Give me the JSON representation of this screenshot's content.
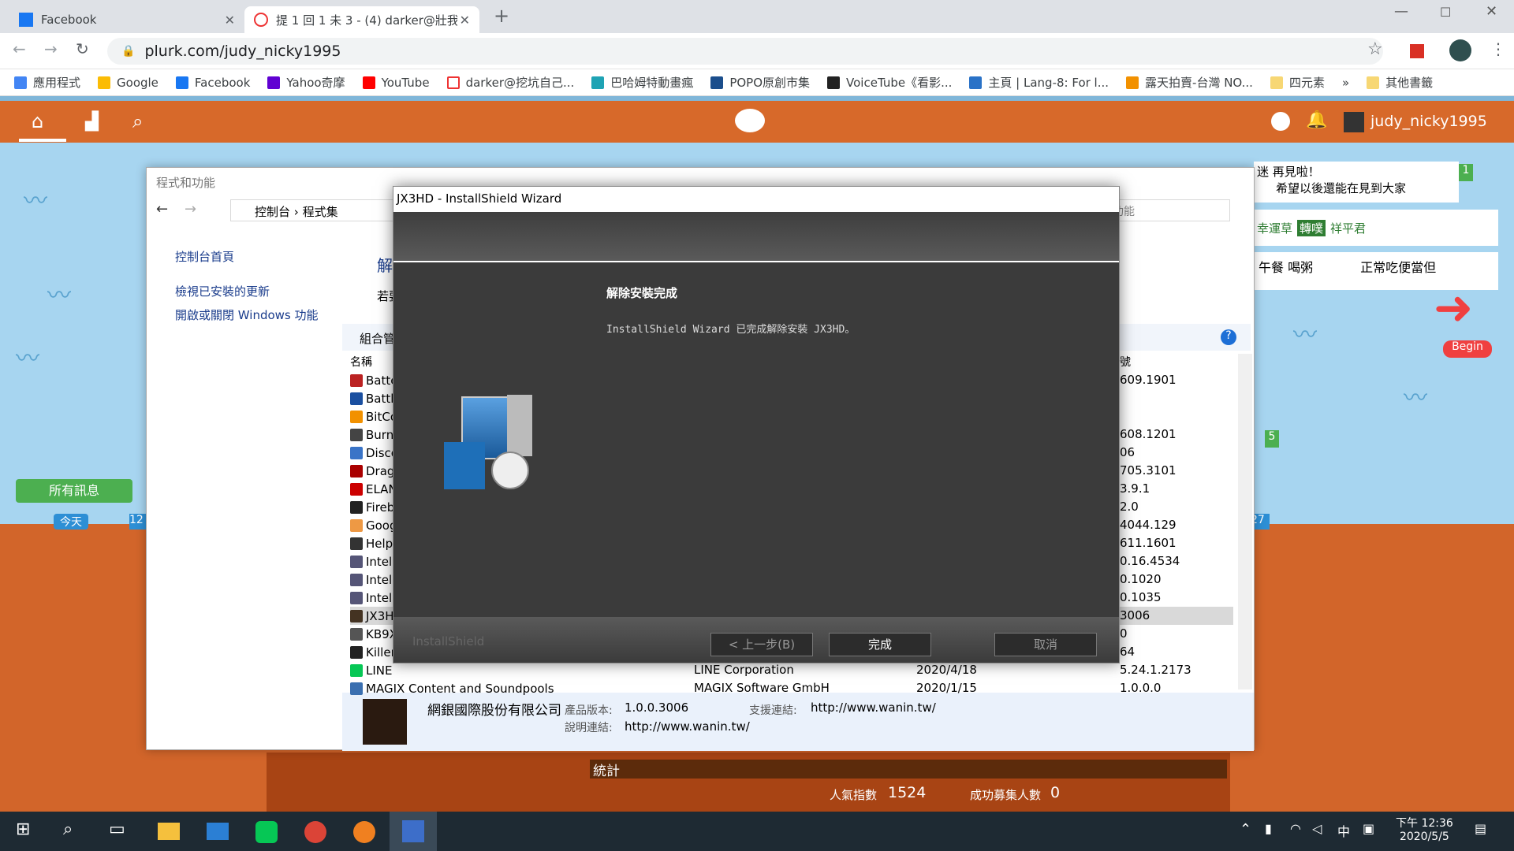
{
  "browser": {
    "tabs": [
      {
        "title": "Facebook"
      },
      {
        "title": "提 1 回 1 未 3 - (4) darker@壯我"
      }
    ],
    "url": "plurk.com/judy_nicky1995",
    "bookmarks": [
      "應用程式",
      "Google",
      "Facebook",
      "Yahoo奇摩",
      "YouTube",
      "darker@挖坑自己...",
      "巴哈姆特動畫瘋",
      "POPO原創市集",
      "VoiceTube《看影...",
      "主頁 | Lang-8: For l...",
      "露天拍賣-台灣 NO...",
      "四元素",
      "»",
      "其他書籤"
    ]
  },
  "plurk": {
    "username": "judy_nicky1995",
    "all_messages": "所有訊息",
    "today": "今天",
    "num12": "12",
    "num27": "27",
    "badge1": "1",
    "badge5": "5",
    "begin": "Begin",
    "bubble1": "迷 再見啦！",
    "bubble1b": "希望以後還能在見到大家",
    "lucky": "幸運草",
    "retweet": "轉噗",
    "peace": "祥平君",
    "lunch": "午餐 喝粥",
    "normal": "正常吃便當但",
    "stats": "統計",
    "popularity_label": "人氣指數",
    "popularity_value": "1524",
    "recruit_label": "成功募集人數",
    "recruit_value": "0"
  },
  "control_panel": {
    "title": "程式和功能",
    "breadcrumb": [
      "控制台",
      "程式集"
    ],
    "side_links": [
      "控制台首頁",
      "檢視已安裝的更新",
      "開啟或關閉 Windows 功能"
    ],
    "heading_partial": "解",
    "sub_partial": "若要",
    "organize": "組合管",
    "col_name": "名稱",
    "col_version_partial": "號",
    "search_partial": "功能",
    "rows": [
      {
        "name": "Batte",
        "ver": "609.1901"
      },
      {
        "name": "Battle",
        "ver": ""
      },
      {
        "name": "BitCo",
        "ver": ""
      },
      {
        "name": "Burn",
        "ver": "608.1201"
      },
      {
        "name": "Disco",
        "ver": "06"
      },
      {
        "name": "Drag",
        "ver": "705.3101"
      },
      {
        "name": "ELAN",
        "ver": "3.9.1"
      },
      {
        "name": "Fireb",
        "ver": "2.0"
      },
      {
        "name": "Goog",
        "ver": "4044.129"
      },
      {
        "name": "Help",
        "ver": "611.1601"
      },
      {
        "name": "Intel(",
        "ver": "0.16.4534"
      },
      {
        "name": "Intel(",
        "ver": "0.1020"
      },
      {
        "name": "Intel(",
        "ver": "0.1035"
      },
      {
        "name": "JX3H",
        "ver": "3006"
      },
      {
        "name": "KB9X",
        "ver": "0"
      },
      {
        "name": "Killer",
        "ver": "64"
      },
      {
        "name": "LINE",
        "ver": "5.24.1.2173",
        "publisher": "LINE Corporation",
        "date": "2020/4/18"
      },
      {
        "name": "MAGIX Content and Soundpools",
        "ver": "1.0.0.0",
        "publisher": "MAGIX Software GmbH",
        "date": "2020/1/15"
      }
    ],
    "detail": {
      "company": "網銀國際股份有限公司",
      "product_version_label": "產品版本:",
      "product_version": "1.0.0.3006",
      "support_label": "支援連結:",
      "support_url": "http://www.wanin.tw/",
      "help_label": "說明連結:",
      "help_url": "http://www.wanin.tw/"
    }
  },
  "wizard": {
    "title": "JX3HD - InstallShield Wizard",
    "heading": "解除安裝完成",
    "message": "InstallShield Wizard 已完成解除安裝 JX3HD。",
    "brand": "InstallShield",
    "back": "< 上一步(B)",
    "finish": "完成",
    "cancel": "取消"
  },
  "taskbar": {
    "time": "下午 12:36",
    "date": "2020/5/5",
    "ime": "中",
    "notif": "1"
  }
}
